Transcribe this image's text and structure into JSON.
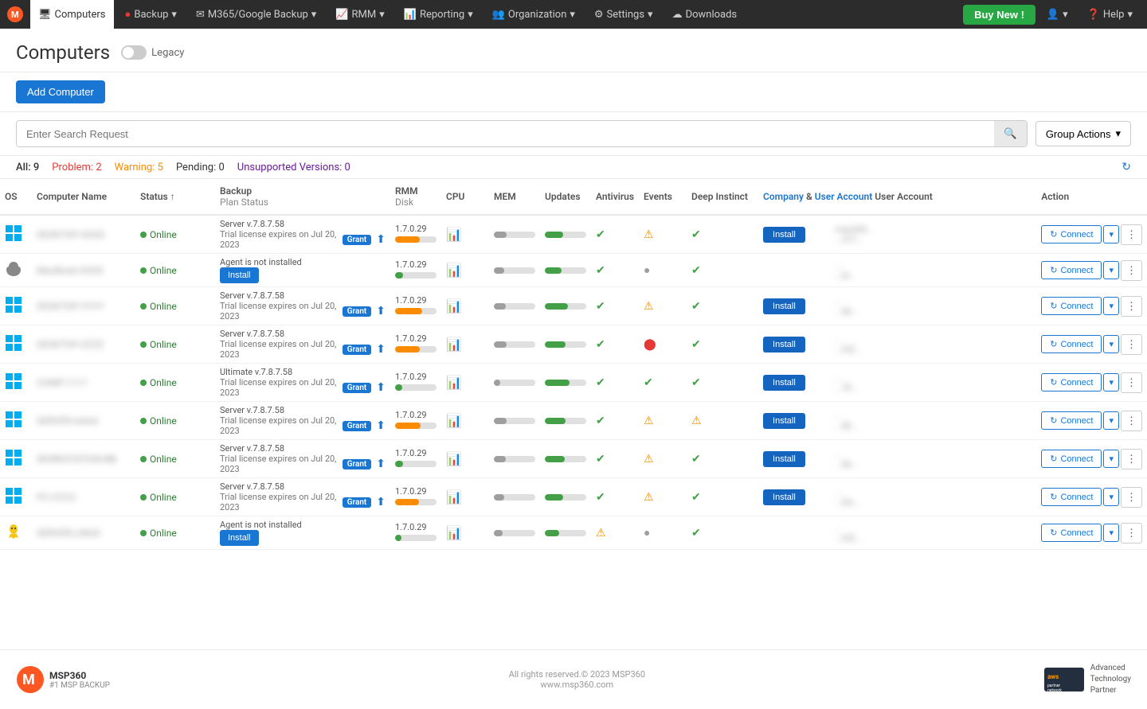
{
  "navbar": {
    "logo_alt": "MSP360",
    "items": [
      {
        "label": "Computers",
        "icon": "🖥",
        "active": true
      },
      {
        "label": "Backup",
        "icon": "🔴",
        "has_dropdown": true
      },
      {
        "label": "M365/Google Backup",
        "icon": "✉",
        "has_dropdown": true
      },
      {
        "label": "RMM",
        "icon": "📈",
        "has_dropdown": true
      },
      {
        "label": "Reporting",
        "icon": "📊",
        "has_dropdown": true
      },
      {
        "label": "Organization",
        "icon": "👥",
        "has_dropdown": true
      },
      {
        "label": "Settings",
        "icon": "⚙",
        "has_dropdown": true
      },
      {
        "label": "Downloads",
        "icon": "☁",
        "has_dropdown": false
      }
    ],
    "buy_new": "Buy New !",
    "user_icon": "👤",
    "help_label": "Help"
  },
  "page": {
    "title": "Computers",
    "legacy_label": "Legacy"
  },
  "toolbar": {
    "add_computer": "Add Computer"
  },
  "search": {
    "placeholder": "Enter Search Request",
    "group_actions": "Group Actions"
  },
  "filters": {
    "all": "All: 9",
    "problem": "Problem: 2",
    "warning": "Warning: 5",
    "pending": "Pending: 0",
    "unsupported": "Unsupported Versions: 0"
  },
  "table": {
    "columns": {
      "os": "OS",
      "name": "Computer Name",
      "status": "Status ↑",
      "backup": "Backup",
      "backup_sub": "Plan Status",
      "rmm": "RMM",
      "disk": "Disk",
      "cpu": "CPU",
      "mem": "MEM",
      "updates": "Updates",
      "antivirus": "Antivirus",
      "events": "Events",
      "deep_instinct": "Deep Instinct",
      "company": "Company",
      "user_account": "User Account",
      "action": "Action"
    },
    "company_link": "Company",
    "user_account_link": "User Account",
    "rows": [
      {
        "os": "windows",
        "name": "DESKTOP-XXXX",
        "status": "Online",
        "backup_plan": "Server v.7.8.7.58",
        "backup_trial": "Trial license expires on Jul 20, 2023",
        "backup_action": "grant",
        "rmm_version": "1.7.0.29",
        "disk_pct": 60,
        "disk_color": "orange",
        "cpu_pct": 30,
        "cpu_color": "gray",
        "mem_pct": 45,
        "mem_color": "green",
        "updates": "ok",
        "antivirus": "warn",
        "events": "ok",
        "deep_instinct": "install",
        "company": "msp360...",
        "user_account": "...377...",
        "connect": "Connect"
      },
      {
        "os": "mac",
        "name": "MacBook-XXXX",
        "status": "Online",
        "backup_plan": "Agent is not installed",
        "backup_action": "install",
        "rmm_version": "1.7.0.29",
        "disk_pct": 20,
        "disk_color": "green",
        "cpu_pct": 25,
        "cpu_color": "gray",
        "mem_pct": 40,
        "mem_color": "green",
        "updates": "ok",
        "antivirus": "dot",
        "events": "ok",
        "deep_instinct": "",
        "company": "...",
        "user_account": "...bl...",
        "connect": "Connect"
      },
      {
        "os": "windows",
        "name": "DESKTOP-YYYY",
        "status": "Online",
        "backup_plan": "Server v.7.8.7.58",
        "backup_trial": "Trial license expires on Jul 20, 2023",
        "backup_action": "grant",
        "rmm_version": "1.7.0.29",
        "disk_pct": 65,
        "disk_color": "orange",
        "cpu_pct": 28,
        "cpu_color": "gray",
        "mem_pct": 55,
        "mem_color": "green",
        "updates": "ok",
        "antivirus": "warn",
        "events": "ok",
        "deep_instinct": "install",
        "company": "...",
        "user_account": "...66...",
        "connect": "Connect"
      },
      {
        "os": "windows",
        "name": "DESKTOP-ZZZZ",
        "status": "Online",
        "backup_plan": "Server v.7.8.7.58",
        "backup_trial": "Trial license expires on Jul 20, 2023",
        "backup_action": "grant",
        "rmm_version": "1.7.0.29",
        "disk_pct": 60,
        "disk_color": "orange",
        "cpu_pct": 30,
        "cpu_color": "gray",
        "mem_pct": 50,
        "mem_color": "green",
        "updates": "ok",
        "antivirus": "red",
        "events": "ok",
        "deep_instinct": "install",
        "company": "...",
        "user_account": "...ICE...",
        "connect": "Connect"
      },
      {
        "os": "windows",
        "name": "COMP-1111",
        "status": "Online",
        "backup_plan": "Ultimate v.7.8.7.58",
        "backup_trial": "Trial license expires on Jul 20, 2023",
        "backup_action": "grant",
        "rmm_version": "1.7.0.29",
        "disk_pct": 18,
        "disk_color": "green",
        "cpu_pct": 15,
        "cpu_color": "gray",
        "mem_pct": 60,
        "mem_color": "green",
        "updates": "ok",
        "antivirus": "ok",
        "events": "ok",
        "deep_instinct": "install",
        "company": "...",
        "user_account": "...7E...",
        "connect": "Connect"
      },
      {
        "os": "windows",
        "name": "SERVER-AAAA",
        "status": "Online",
        "backup_plan": "Server v.7.8.7.58",
        "backup_trial": "Trial license expires on Jul 20, 2023",
        "backup_action": "grant",
        "rmm_version": "1.7.0.29",
        "disk_pct": 62,
        "disk_color": "orange",
        "cpu_pct": 30,
        "cpu_color": "gray",
        "mem_pct": 50,
        "mem_color": "green",
        "updates": "ok",
        "antivirus": "warn",
        "events": "warn",
        "deep_instinct": "install",
        "company": "...",
        "user_account": "...6E...",
        "connect": "Connect"
      },
      {
        "os": "windows",
        "name": "WORKSTATION-BB",
        "status": "Online",
        "backup_plan": "Server v.7.8.7.58",
        "backup_trial": "Trial license expires on Jul 20, 2023",
        "backup_action": "grant",
        "rmm_version": "1.7.0.29",
        "disk_pct": 20,
        "disk_color": "green",
        "cpu_pct": 28,
        "cpu_color": "gray",
        "mem_pct": 48,
        "mem_color": "green",
        "updates": "ok",
        "antivirus": "warn",
        "events": "ok",
        "deep_instinct": "install",
        "company": "...",
        "user_account": "...66...",
        "connect": "Connect"
      },
      {
        "os": "windows",
        "name": "PC-CCCC",
        "status": "Online",
        "backup_plan": "Server v.7.8.7.58",
        "backup_trial": "Trial license expires on Jul 20, 2023",
        "backup_action": "grant",
        "rmm_version": "1.7.0.29",
        "disk_pct": 58,
        "disk_color": "orange",
        "cpu_pct": 25,
        "cpu_color": "gray",
        "mem_pct": 45,
        "mem_color": "green",
        "updates": "ok",
        "antivirus": "warn",
        "events": "ok",
        "deep_instinct": "install",
        "company": "...",
        "user_account": "...DA...",
        "connect": "Connect"
      },
      {
        "os": "linux",
        "name": "SERVER-LINUX",
        "status": "Online",
        "backup_plan": "Agent is not installed",
        "backup_action": "install",
        "rmm_version": "1.7.0.29",
        "disk_pct": 16,
        "disk_color": "green",
        "cpu_pct": 22,
        "cpu_color": "gray",
        "mem_pct": 35,
        "mem_color": "green",
        "updates": "warn",
        "antivirus": "dot",
        "events": "ok",
        "deep_instinct": "",
        "company": "...",
        "user_account": "...ICE...",
        "connect": "Connect"
      }
    ]
  },
  "footer": {
    "logo_text": "MSP360",
    "logo_sub": "#1 MSP BACKUP",
    "copyright": "All rights reserved.© 2023 MSP360",
    "website": "www.msp360.com",
    "aws_text": "aws\npartner\nnetwork",
    "aws_sub": "Advanced\nTechnology\nPartner"
  }
}
